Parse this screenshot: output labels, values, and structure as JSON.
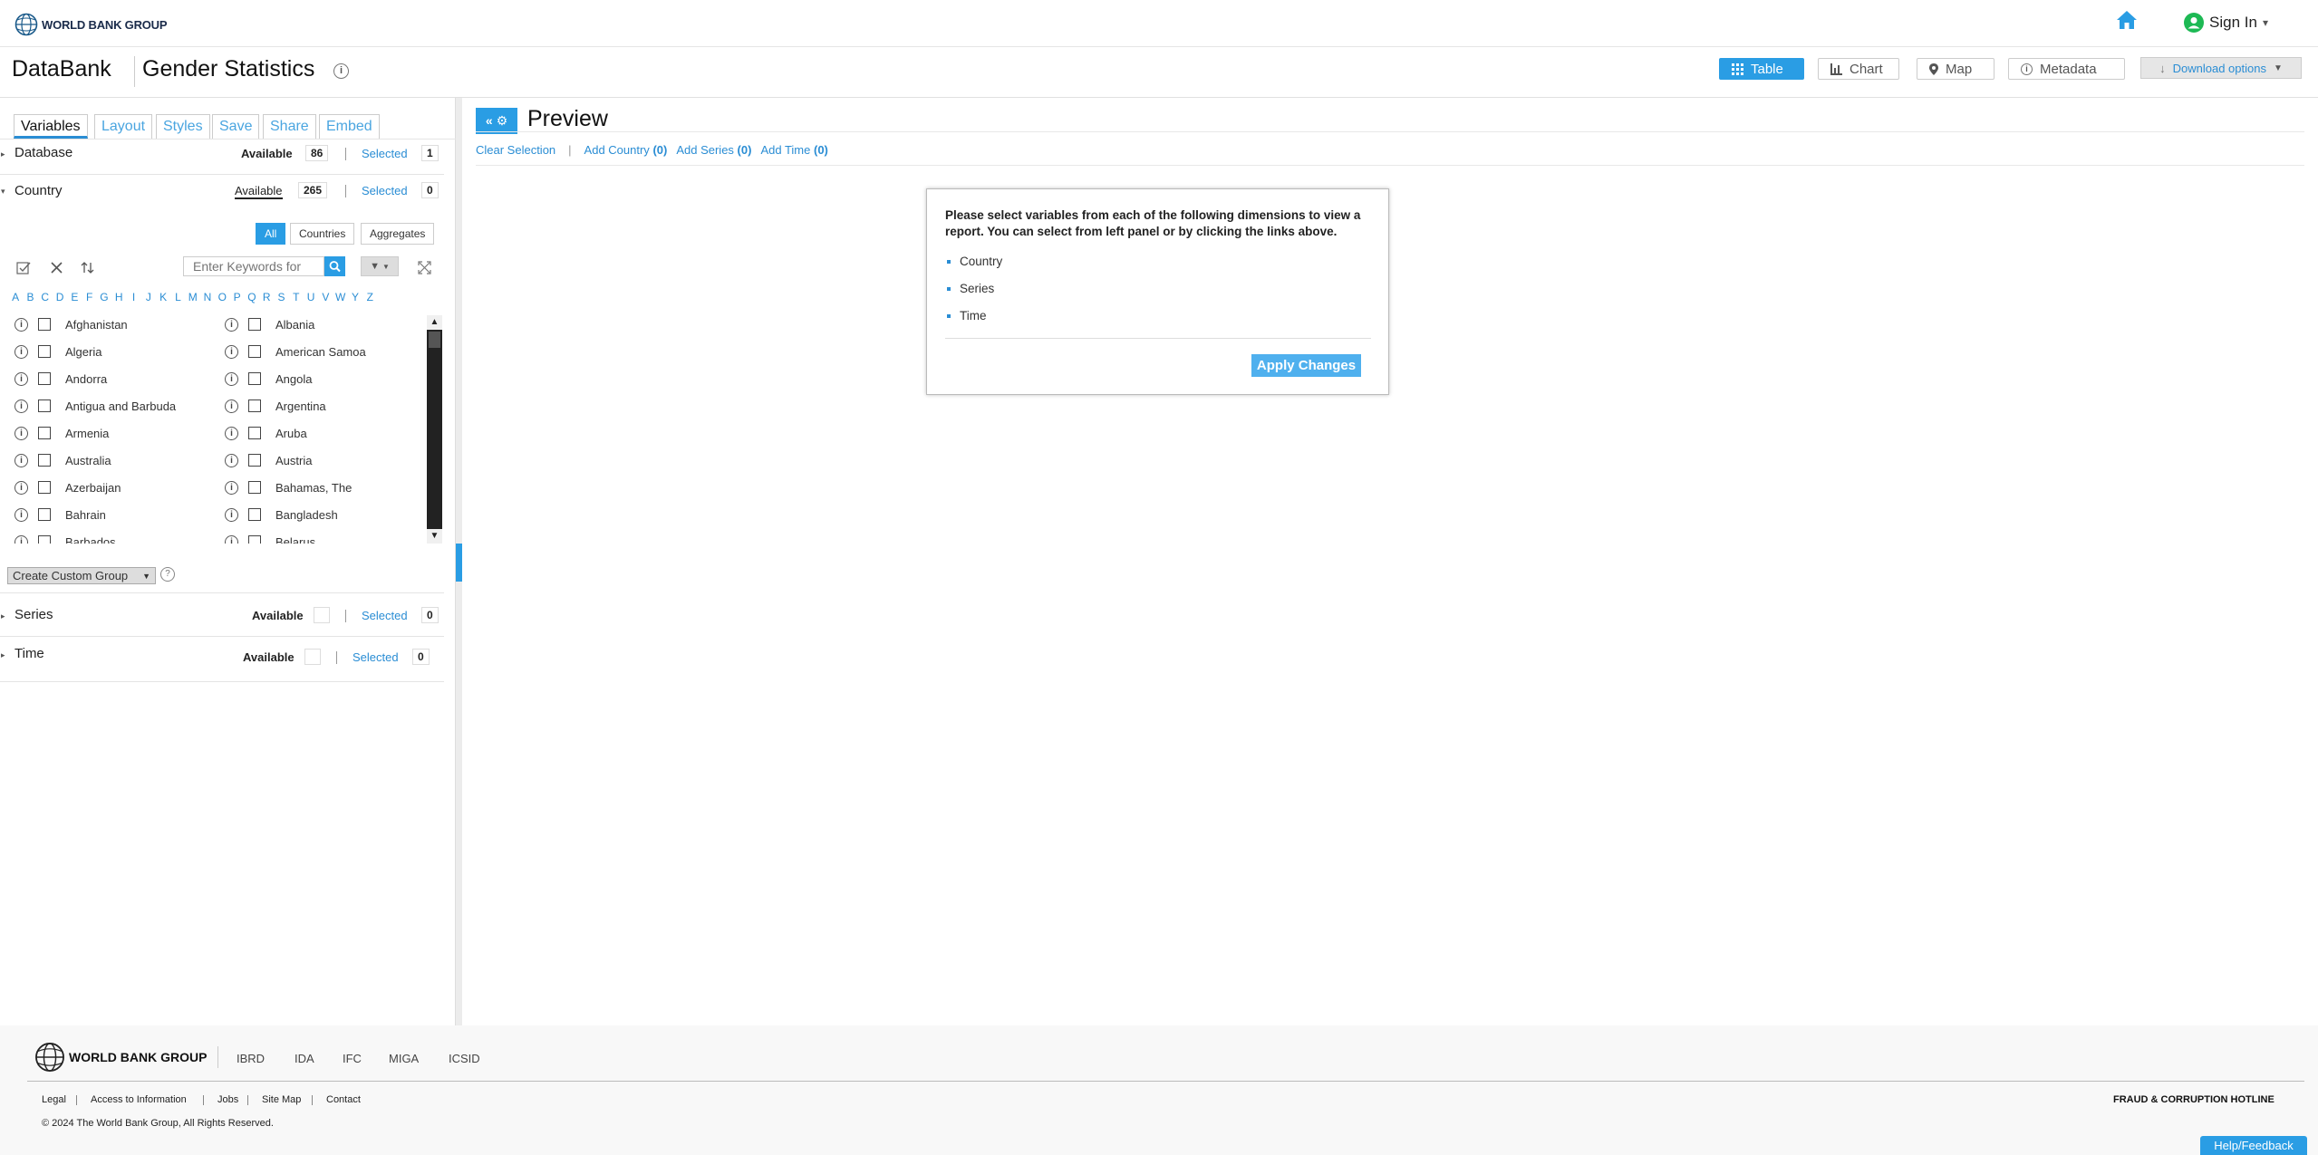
{
  "header": {
    "logo_text": "WORLD BANK GROUP",
    "signin_label": "Sign In"
  },
  "titlebar": {
    "brand": "DataBank",
    "title": "Gender Statistics",
    "views": [
      "Table",
      "Chart",
      "Map",
      "Metadata"
    ],
    "download_label": "Download options"
  },
  "tabs": [
    "Variables",
    "Layout",
    "Styles",
    "Save",
    "Share",
    "Embed"
  ],
  "sections": {
    "database": {
      "title": "Database",
      "available_label": "Available",
      "available": "86",
      "selected_label": "Selected",
      "selected": "1"
    },
    "country": {
      "title": "Country",
      "available_label": "Available",
      "available": "265",
      "selected_label": "Selected",
      "selected": "0"
    },
    "series": {
      "title": "Series",
      "available_label": "Available",
      "available": "",
      "selected_label": "Selected",
      "selected": "0"
    },
    "time": {
      "title": "Time",
      "available_label": "Available",
      "available": "",
      "selected_label": "Selected",
      "selected": "0"
    }
  },
  "country_filters": [
    "All",
    "Countries",
    "Aggregates"
  ],
  "search": {
    "placeholder": "Enter Keywords for"
  },
  "alphabet": [
    "A",
    "B",
    "C",
    "D",
    "E",
    "F",
    "G",
    "H",
    "I",
    "J",
    "K",
    "L",
    "M",
    "N",
    "O",
    "P",
    "Q",
    "R",
    "S",
    "T",
    "U",
    "V",
    "W",
    "Y",
    "Z"
  ],
  "countries_left": [
    "Afghanistan",
    "Algeria",
    "Andorra",
    "Antigua and Barbuda",
    "Armenia",
    "Australia",
    "Azerbaijan",
    "Bahrain",
    "Barbados"
  ],
  "countries_right": [
    "Albania",
    "American Samoa",
    "Angola",
    "Argentina",
    "Aruba",
    "Austria",
    "Bahamas, The",
    "Bangladesh",
    "Belarus"
  ],
  "custom_group_label": "Create Custom Group",
  "preview": {
    "title": "Preview",
    "clear": "Clear Selection",
    "add_country": "Add Country",
    "add_country_count": "(0)",
    "add_series": "Add Series",
    "add_series_count": "(0)",
    "add_time": "Add Time",
    "add_time_count": "(0)"
  },
  "dialog": {
    "message": "Please select variables from each of the following dimensions to view a report. You can select from left panel or by clicking the links above.",
    "items": [
      "Country",
      "Series",
      "Time"
    ],
    "apply_label": "Apply Changes"
  },
  "footer": {
    "logo_text": "WORLD BANK GROUP",
    "orgs": [
      "IBRD",
      "IDA",
      "IFC",
      "MIGA",
      "ICSID"
    ],
    "links": [
      "Legal",
      "Access to Information",
      "Jobs",
      "Site Map",
      "Contact"
    ],
    "copyright": "© 2024 The World Bank Group, All Rights Reserved.",
    "hotline": "FRAUD & CORRUPTION HOTLINE",
    "help": "Help/Feedback"
  },
  "colors": {
    "accent": "#2a9de4",
    "link": "#2a8dd4"
  }
}
